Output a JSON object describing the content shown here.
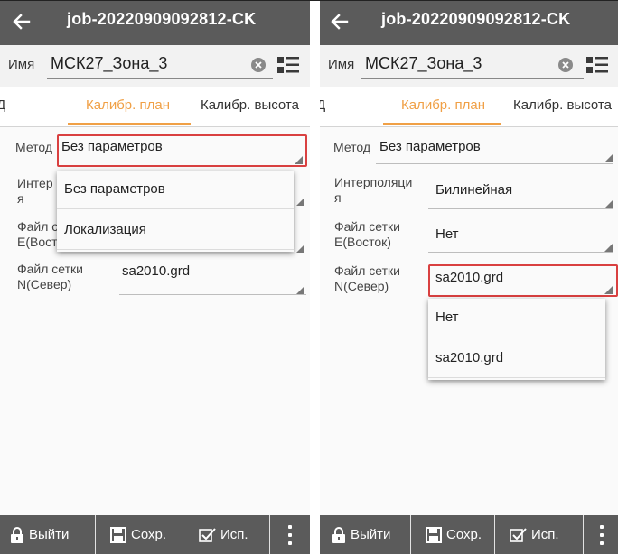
{
  "left": {
    "title": "job-20220909092812-CK",
    "name_label": "Имя",
    "name_value": "МСК27_Зона_3",
    "tabs": [
      "Д",
      "Калибр. план",
      "Калибр. высота"
    ],
    "fields": [
      {
        "label": "Метод",
        "value": "Без параметров"
      },
      {
        "label": "Интер\nя",
        "value": ""
      },
      {
        "label": "Файл с\nЕ(Вост",
        "value": ""
      },
      {
        "label": "Файл сетки\nN(Север)",
        "value": "sa2010.grd"
      }
    ],
    "dropdown_options": [
      "Без параметров",
      "Локализация"
    ],
    "bottom": {
      "exit": "Выйти",
      "save": "Сохр.",
      "apply": "Исп."
    }
  },
  "right": {
    "title": "job-20220909092812-CK",
    "name_label": "Имя",
    "name_value": "МСК27_Зона_3",
    "tabs": [
      "Д",
      "Калибр. план",
      "Калибр. высота"
    ],
    "fields": [
      {
        "label": "Метод",
        "value": "Без параметров"
      },
      {
        "label": "Интерполяци\nя",
        "value": "Билинейная"
      },
      {
        "label": "Файл сетки\nЕ(Восток)",
        "value": "Нет"
      },
      {
        "label": "Файл сетки\nN(Север)",
        "value": "sa2010.grd"
      }
    ],
    "dropdown_options": [
      "Нет",
      "sa2010.grd"
    ],
    "bottom": {
      "exit": "Выйти",
      "save": "Сохр.",
      "apply": "Исп."
    }
  },
  "colors": {
    "appbar": "#5b5b5b",
    "accent": "#f0a046",
    "highlight": "#d94040"
  },
  "icons": {
    "back": "arrow-left-icon",
    "clear": "clear-circle-icon",
    "list": "list-icon",
    "lock": "lock-icon",
    "save": "floppy-icon",
    "apply": "checkbox-icon",
    "more": "more-vertical-icon"
  }
}
